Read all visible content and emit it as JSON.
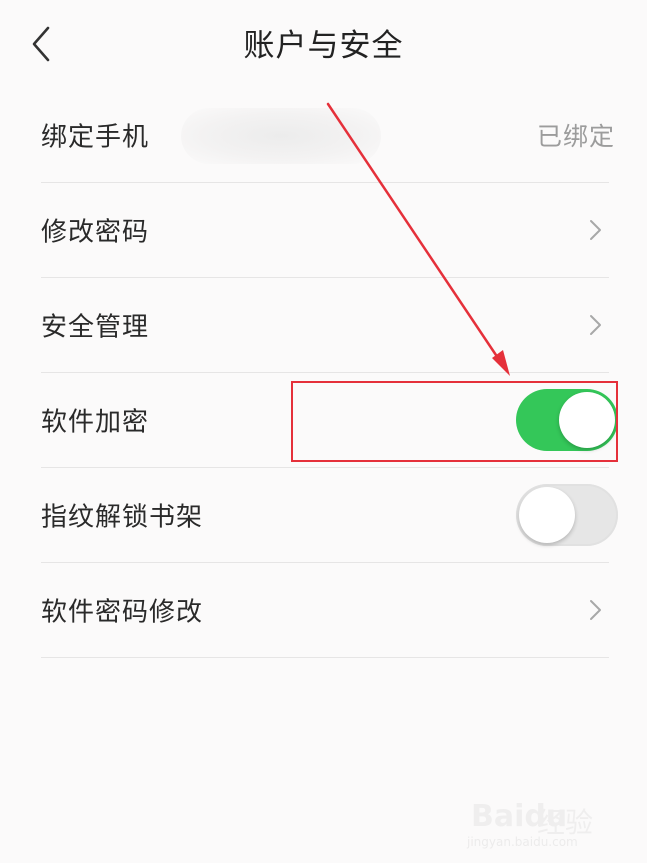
{
  "header": {
    "title": "账户与安全"
  },
  "rows": [
    {
      "label": "绑定手机",
      "value": "已绑定"
    },
    {
      "label": "修改密码"
    },
    {
      "label": "安全管理"
    },
    {
      "label": "软件加密",
      "toggle": "on"
    },
    {
      "label": "指纹解锁书架",
      "toggle": "off"
    },
    {
      "label": "软件密码修改"
    }
  ],
  "colors": {
    "toggle_on": "#34c759",
    "toggle_off": "#e6e6e6",
    "annotation": "#e5303a"
  },
  "icons": {
    "back": "chevron-left-icon",
    "row_arrow": "chevron-right-icon"
  },
  "watermark": {
    "brand": "Baidu",
    "brand_cn": "经验",
    "url": "jingyan.baidu.com"
  }
}
